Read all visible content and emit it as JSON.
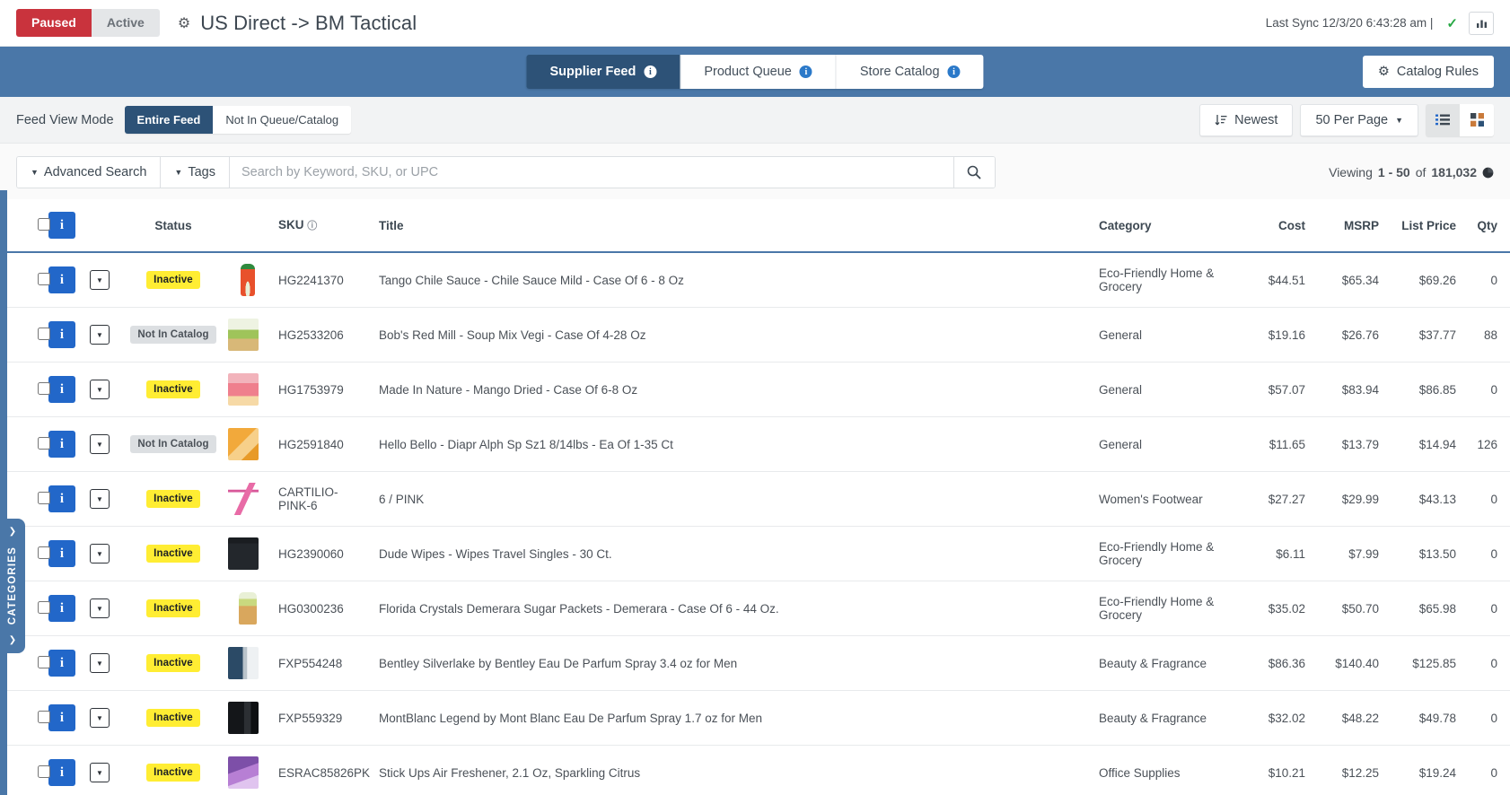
{
  "topbar": {
    "status_paused": "Paused",
    "status_active": "Active",
    "gear_icon": "gear-icon",
    "title": "US Direct -> BM Tactical",
    "sync_text": "Last Sync 12/3/20 6:43:28 am |",
    "check_icon": "check-icon",
    "chart_icon": "bar-chart-icon"
  },
  "nav": {
    "tabs": [
      {
        "label": "Supplier Feed",
        "active": true
      },
      {
        "label": "Product Queue",
        "active": false
      },
      {
        "label": "Store Catalog",
        "active": false
      }
    ],
    "catalog_rules": "Catalog Rules"
  },
  "viewmode": {
    "label": "Feed View Mode",
    "options": [
      {
        "label": "Entire Feed",
        "active": true
      },
      {
        "label": "Not In Queue/Catalog",
        "active": false
      }
    ],
    "sort_label": "Newest",
    "per_page_label": "50 Per Page",
    "list_view_icon": "list-view-icon",
    "grid_view_icon": "grid-view-icon"
  },
  "search": {
    "advanced_label": "Advanced Search",
    "tags_label": "Tags",
    "placeholder": "Search by Keyword, SKU, or UPC",
    "value": "",
    "search_icon": "search-icon",
    "viewing_prefix": "Viewing",
    "viewing_range": "1 - 50",
    "viewing_middle": "of",
    "viewing_total": "181,032",
    "pie_icon": "pie-chart-icon"
  },
  "table": {
    "headers": {
      "status": "Status",
      "sku": "SKU",
      "title": "Title",
      "category": "Category",
      "cost": "Cost",
      "msrp": "MSRP",
      "list_price": "List Price",
      "qty": "Qty"
    },
    "sku_help_icon": "question-circle-icon",
    "rows": [
      {
        "status": "Inactive",
        "status_type": "inactive",
        "thumb": "t-sauce",
        "sku": "HG2241370",
        "title": "Tango Chile Sauce - Chile Sauce Mild - Case Of 6 - 8 Oz",
        "category": "Eco-Friendly Home & Grocery",
        "cost": "$44.51",
        "msrp": "$65.34",
        "list_price": "$69.26",
        "qty": "0"
      },
      {
        "status": "Not In Catalog",
        "status_type": "notincatalog",
        "thumb": "t-soup",
        "sku": "HG2533206",
        "title": "Bob's Red Mill - Soup Mix Vegi - Case Of 4-28 Oz",
        "category": "General",
        "cost": "$19.16",
        "msrp": "$26.76",
        "list_price": "$37.77",
        "qty": "88"
      },
      {
        "status": "Inactive",
        "status_type": "inactive",
        "thumb": "t-mango",
        "sku": "HG1753979",
        "title": "Made In Nature - Mango Dried - Case Of 6-8 Oz",
        "category": "General",
        "cost": "$57.07",
        "msrp": "$83.94",
        "list_price": "$86.85",
        "qty": "0"
      },
      {
        "status": "Not In Catalog",
        "status_type": "notincatalog",
        "thumb": "t-diaper",
        "sku": "HG2591840",
        "title": "Hello Bello - Diapr Alph Sp Sz1 8/14lbs - Ea Of 1-35 Ct",
        "category": "General",
        "cost": "$11.65",
        "msrp": "$13.79",
        "list_price": "$14.94",
        "qty": "126"
      },
      {
        "status": "Inactive",
        "status_type": "inactive",
        "thumb": "t-shoe",
        "sku": "CARTILIO-PINK-6",
        "title": "6 / PINK",
        "category": "Women's Footwear",
        "cost": "$27.27",
        "msrp": "$29.99",
        "list_price": "$43.13",
        "qty": "0"
      },
      {
        "status": "Inactive",
        "status_type": "inactive",
        "thumb": "t-wipes",
        "sku": "HG2390060",
        "title": "Dude Wipes - Wipes Travel Singles - 30 Ct.",
        "category": "Eco-Friendly Home & Grocery",
        "cost": "$6.11",
        "msrp": "$7.99",
        "list_price": "$13.50",
        "qty": "0"
      },
      {
        "status": "Inactive",
        "status_type": "inactive",
        "thumb": "t-sugar",
        "sku": "HG0300236",
        "title": "Florida Crystals Demerara Sugar Packets - Demerara - Case Of 6 - 44 Oz.",
        "category": "Eco-Friendly Home & Grocery",
        "cost": "$35.02",
        "msrp": "$50.70",
        "list_price": "$65.98",
        "qty": "0"
      },
      {
        "status": "Inactive",
        "status_type": "inactive",
        "thumb": "t-bentley",
        "sku": "FXP554248",
        "title": "Bentley Silverlake by Bentley Eau De Parfum Spray 3.4 oz for Men",
        "category": "Beauty & Fragrance",
        "cost": "$86.36",
        "msrp": "$140.40",
        "list_price": "$125.85",
        "qty": "0"
      },
      {
        "status": "Inactive",
        "status_type": "inactive",
        "thumb": "t-montblanc",
        "sku": "FXP559329",
        "title": "MontBlanc Legend by Mont Blanc Eau De Parfum Spray 1.7 oz for Men",
        "category": "Beauty & Fragrance",
        "cost": "$32.02",
        "msrp": "$48.22",
        "list_price": "$49.78",
        "qty": "0"
      },
      {
        "status": "Inactive",
        "status_type": "inactive",
        "thumb": "t-airfresh",
        "sku": "ESRAC85826PK",
        "title": "Stick Ups Air Freshener, 2.1 Oz, Sparkling Citrus",
        "category": "Office Supplies",
        "cost": "$10.21",
        "msrp": "$12.25",
        "list_price": "$19.24",
        "qty": "0"
      }
    ]
  },
  "sidebar": {
    "categories_label": "CATEGORIES",
    "chevron_icon": "chevron-right-icon"
  },
  "colors": {
    "brand_blue": "#4a77a8",
    "dark_blue": "#2d5277",
    "paused_red": "#c9333d",
    "inactive_yellow": "#ffed33",
    "info_blue": "#2267c9"
  }
}
